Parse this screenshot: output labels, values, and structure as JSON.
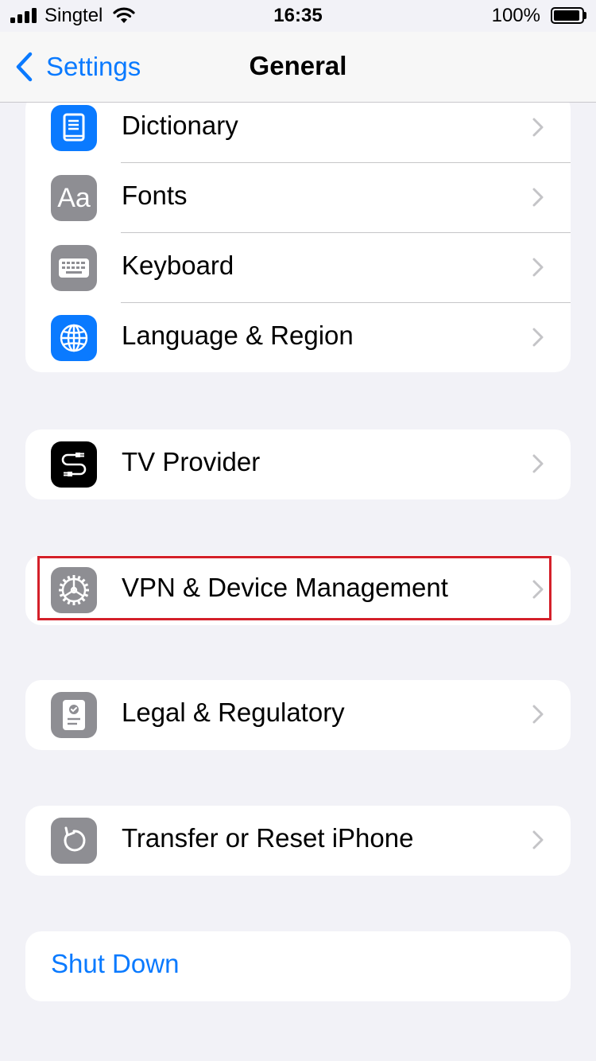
{
  "status_bar": {
    "carrier": "Singtel",
    "time": "16:35",
    "battery_percent": "100%",
    "battery_level": 1.0
  },
  "nav": {
    "back_label": "Settings",
    "title": "General"
  },
  "groups": [
    {
      "items": [
        {
          "label": "Dictionary",
          "icon": "book-icon",
          "icon_bg": "#0a7aff"
        },
        {
          "label": "Fonts",
          "icon": "fonts-aa-icon",
          "icon_bg": "#8e8e93",
          "icon_text": "Aa"
        },
        {
          "label": "Keyboard",
          "icon": "keyboard-icon",
          "icon_bg": "#8e8e93"
        },
        {
          "label": "Language & Region",
          "icon": "globe-icon",
          "icon_bg": "#0a7aff"
        }
      ]
    },
    {
      "items": [
        {
          "label": "TV Provider",
          "icon": "tv-provider-icon",
          "icon_bg": "#000000"
        }
      ]
    },
    {
      "items": [
        {
          "label": "VPN & Device Management",
          "icon": "gear-icon",
          "icon_bg": "#8e8e93",
          "highlighted": true
        }
      ]
    },
    {
      "items": [
        {
          "label": "Legal & Regulatory",
          "icon": "certificate-icon",
          "icon_bg": "#8e8e93"
        }
      ]
    },
    {
      "items": [
        {
          "label": "Transfer or Reset iPhone",
          "icon": "reset-icon",
          "icon_bg": "#8e8e93"
        }
      ]
    },
    {
      "items": [
        {
          "label": "Shut Down"
        }
      ]
    }
  ],
  "colors": {
    "accent": "#0a7aff",
    "highlight_border": "#d4202a",
    "background": "#f2f2f7"
  }
}
